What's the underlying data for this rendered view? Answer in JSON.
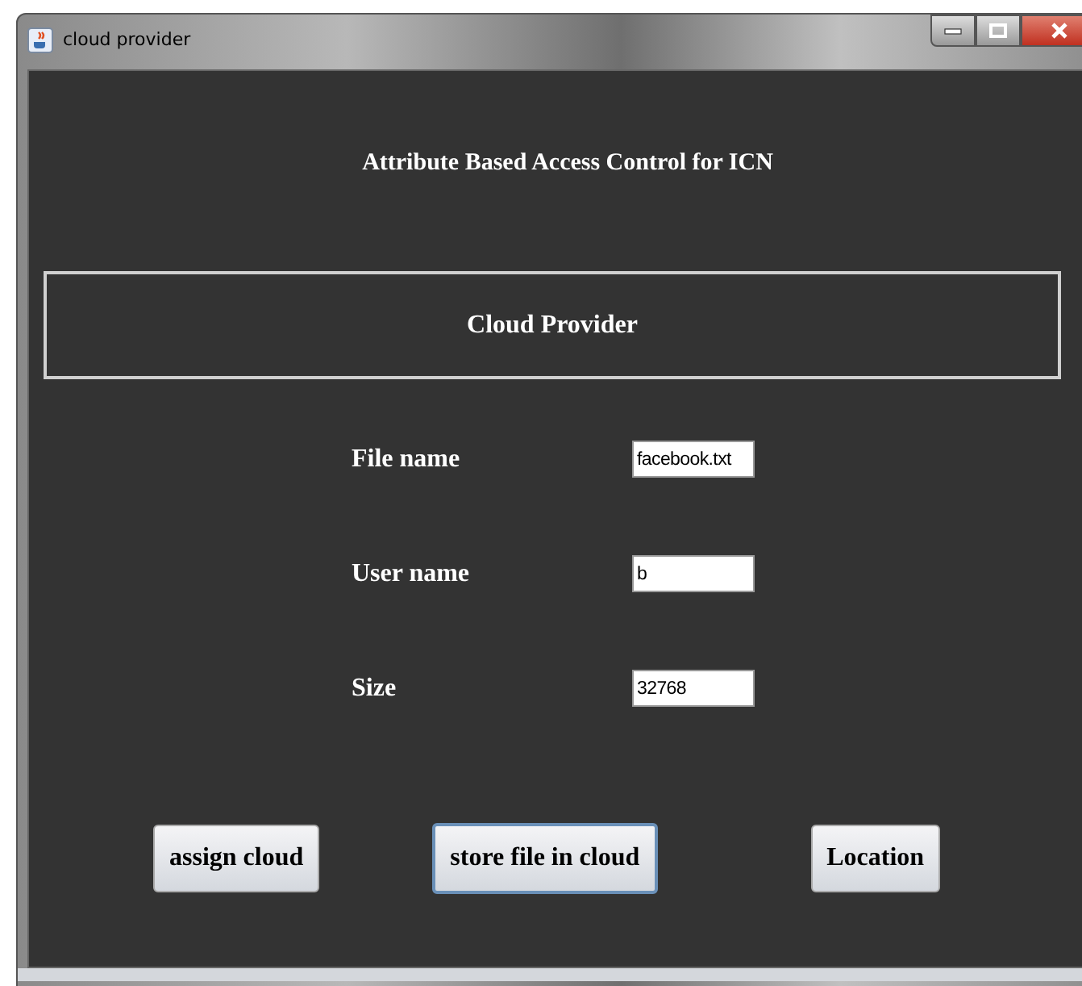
{
  "window": {
    "title": "cloud provider"
  },
  "heading": "Attribute Based Access Control for ICN",
  "panel": {
    "title": "Cloud Provider"
  },
  "fields": [
    {
      "label": "File name",
      "value": "facebook.txt"
    },
    {
      "label": "User name",
      "value": "b"
    },
    {
      "label": "Size",
      "value": "32768"
    }
  ],
  "buttons": [
    {
      "label": "assign cloud",
      "focused": false
    },
    {
      "label": "store file in cloud",
      "focused": true
    },
    {
      "label": "Location",
      "focused": false
    }
  ]
}
